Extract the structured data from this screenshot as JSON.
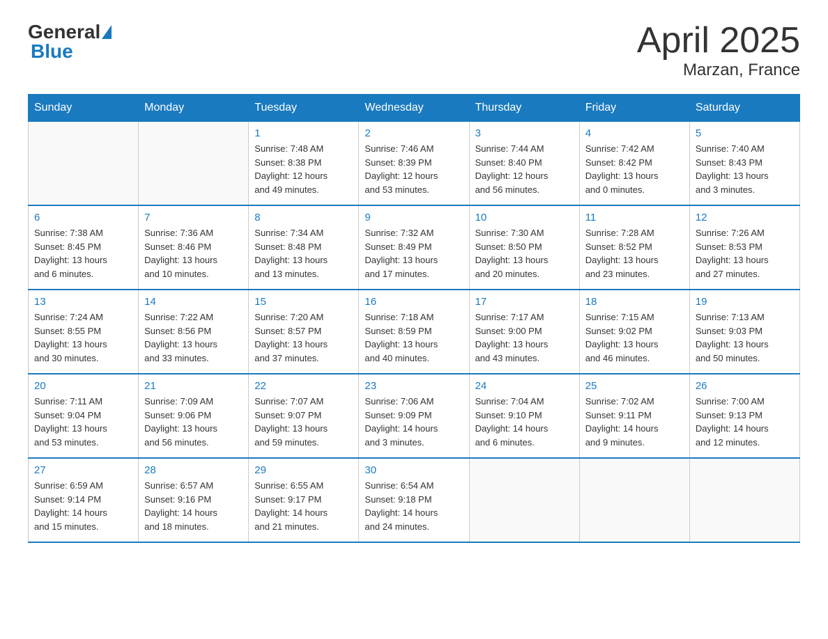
{
  "logo": {
    "general": "General",
    "blue": "Blue"
  },
  "title": "April 2025",
  "location": "Marzan, France",
  "days_of_week": [
    "Sunday",
    "Monday",
    "Tuesday",
    "Wednesday",
    "Thursday",
    "Friday",
    "Saturday"
  ],
  "weeks": [
    [
      {
        "day": "",
        "info": ""
      },
      {
        "day": "",
        "info": ""
      },
      {
        "day": "1",
        "info": "Sunrise: 7:48 AM\nSunset: 8:38 PM\nDaylight: 12 hours\nand 49 minutes."
      },
      {
        "day": "2",
        "info": "Sunrise: 7:46 AM\nSunset: 8:39 PM\nDaylight: 12 hours\nand 53 minutes."
      },
      {
        "day": "3",
        "info": "Sunrise: 7:44 AM\nSunset: 8:40 PM\nDaylight: 12 hours\nand 56 minutes."
      },
      {
        "day": "4",
        "info": "Sunrise: 7:42 AM\nSunset: 8:42 PM\nDaylight: 13 hours\nand 0 minutes."
      },
      {
        "day": "5",
        "info": "Sunrise: 7:40 AM\nSunset: 8:43 PM\nDaylight: 13 hours\nand 3 minutes."
      }
    ],
    [
      {
        "day": "6",
        "info": "Sunrise: 7:38 AM\nSunset: 8:45 PM\nDaylight: 13 hours\nand 6 minutes."
      },
      {
        "day": "7",
        "info": "Sunrise: 7:36 AM\nSunset: 8:46 PM\nDaylight: 13 hours\nand 10 minutes."
      },
      {
        "day": "8",
        "info": "Sunrise: 7:34 AM\nSunset: 8:48 PM\nDaylight: 13 hours\nand 13 minutes."
      },
      {
        "day": "9",
        "info": "Sunrise: 7:32 AM\nSunset: 8:49 PM\nDaylight: 13 hours\nand 17 minutes."
      },
      {
        "day": "10",
        "info": "Sunrise: 7:30 AM\nSunset: 8:50 PM\nDaylight: 13 hours\nand 20 minutes."
      },
      {
        "day": "11",
        "info": "Sunrise: 7:28 AM\nSunset: 8:52 PM\nDaylight: 13 hours\nand 23 minutes."
      },
      {
        "day": "12",
        "info": "Sunrise: 7:26 AM\nSunset: 8:53 PM\nDaylight: 13 hours\nand 27 minutes."
      }
    ],
    [
      {
        "day": "13",
        "info": "Sunrise: 7:24 AM\nSunset: 8:55 PM\nDaylight: 13 hours\nand 30 minutes."
      },
      {
        "day": "14",
        "info": "Sunrise: 7:22 AM\nSunset: 8:56 PM\nDaylight: 13 hours\nand 33 minutes."
      },
      {
        "day": "15",
        "info": "Sunrise: 7:20 AM\nSunset: 8:57 PM\nDaylight: 13 hours\nand 37 minutes."
      },
      {
        "day": "16",
        "info": "Sunrise: 7:18 AM\nSunset: 8:59 PM\nDaylight: 13 hours\nand 40 minutes."
      },
      {
        "day": "17",
        "info": "Sunrise: 7:17 AM\nSunset: 9:00 PM\nDaylight: 13 hours\nand 43 minutes."
      },
      {
        "day": "18",
        "info": "Sunrise: 7:15 AM\nSunset: 9:02 PM\nDaylight: 13 hours\nand 46 minutes."
      },
      {
        "day": "19",
        "info": "Sunrise: 7:13 AM\nSunset: 9:03 PM\nDaylight: 13 hours\nand 50 minutes."
      }
    ],
    [
      {
        "day": "20",
        "info": "Sunrise: 7:11 AM\nSunset: 9:04 PM\nDaylight: 13 hours\nand 53 minutes."
      },
      {
        "day": "21",
        "info": "Sunrise: 7:09 AM\nSunset: 9:06 PM\nDaylight: 13 hours\nand 56 minutes."
      },
      {
        "day": "22",
        "info": "Sunrise: 7:07 AM\nSunset: 9:07 PM\nDaylight: 13 hours\nand 59 minutes."
      },
      {
        "day": "23",
        "info": "Sunrise: 7:06 AM\nSunset: 9:09 PM\nDaylight: 14 hours\nand 3 minutes."
      },
      {
        "day": "24",
        "info": "Sunrise: 7:04 AM\nSunset: 9:10 PM\nDaylight: 14 hours\nand 6 minutes."
      },
      {
        "day": "25",
        "info": "Sunrise: 7:02 AM\nSunset: 9:11 PM\nDaylight: 14 hours\nand 9 minutes."
      },
      {
        "day": "26",
        "info": "Sunrise: 7:00 AM\nSunset: 9:13 PM\nDaylight: 14 hours\nand 12 minutes."
      }
    ],
    [
      {
        "day": "27",
        "info": "Sunrise: 6:59 AM\nSunset: 9:14 PM\nDaylight: 14 hours\nand 15 minutes."
      },
      {
        "day": "28",
        "info": "Sunrise: 6:57 AM\nSunset: 9:16 PM\nDaylight: 14 hours\nand 18 minutes."
      },
      {
        "day": "29",
        "info": "Sunrise: 6:55 AM\nSunset: 9:17 PM\nDaylight: 14 hours\nand 21 minutes."
      },
      {
        "day": "30",
        "info": "Sunrise: 6:54 AM\nSunset: 9:18 PM\nDaylight: 14 hours\nand 24 minutes."
      },
      {
        "day": "",
        "info": ""
      },
      {
        "day": "",
        "info": ""
      },
      {
        "day": "",
        "info": ""
      }
    ]
  ]
}
